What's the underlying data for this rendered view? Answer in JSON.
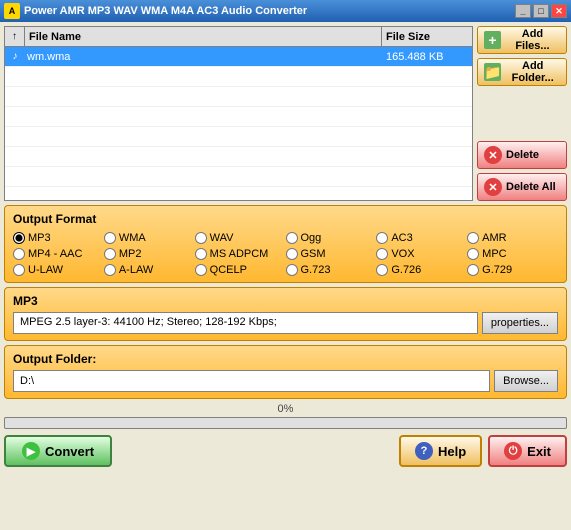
{
  "window": {
    "title": "Power AMR MP3 WAV WMA M4A AC3 Audio Converter"
  },
  "file_list": {
    "col_sort_label": "↑",
    "col_filename": "File Name",
    "col_filesize": "File Size",
    "files": [
      {
        "name": "wm.wma",
        "size": "165.488 KB",
        "icon": "♪"
      }
    ]
  },
  "buttons": {
    "add_files": "Add Files...",
    "add_folder": "Add Folder...",
    "delete": "Delete",
    "delete_all": "Delete All"
  },
  "output_format": {
    "title": "Output Format",
    "formats": [
      [
        "MP3",
        "WMA",
        "WAV",
        "Ogg",
        "AC3",
        "AMR"
      ],
      [
        "MP4 - AAC",
        "MP2",
        "MS ADPCM",
        "GSM",
        "VOX",
        "MPC"
      ],
      [
        "U-LAW",
        "A-LAW",
        "QCELP",
        "G.723",
        "G.726",
        "G.729"
      ]
    ],
    "selected": "MP3"
  },
  "mp3_settings": {
    "title": "MP3",
    "description": "MPEG 2.5 layer-3: 44100 Hz; Stereo;  128-192 Kbps;",
    "properties_btn": "properties..."
  },
  "output_folder": {
    "title": "Output Folder:",
    "path": "D:\\",
    "browse_btn": "Browse..."
  },
  "progress": {
    "label": "0%",
    "value": 0
  },
  "bottom": {
    "convert_btn": "Convert",
    "help_btn": "Help",
    "exit_btn": "Exit"
  }
}
